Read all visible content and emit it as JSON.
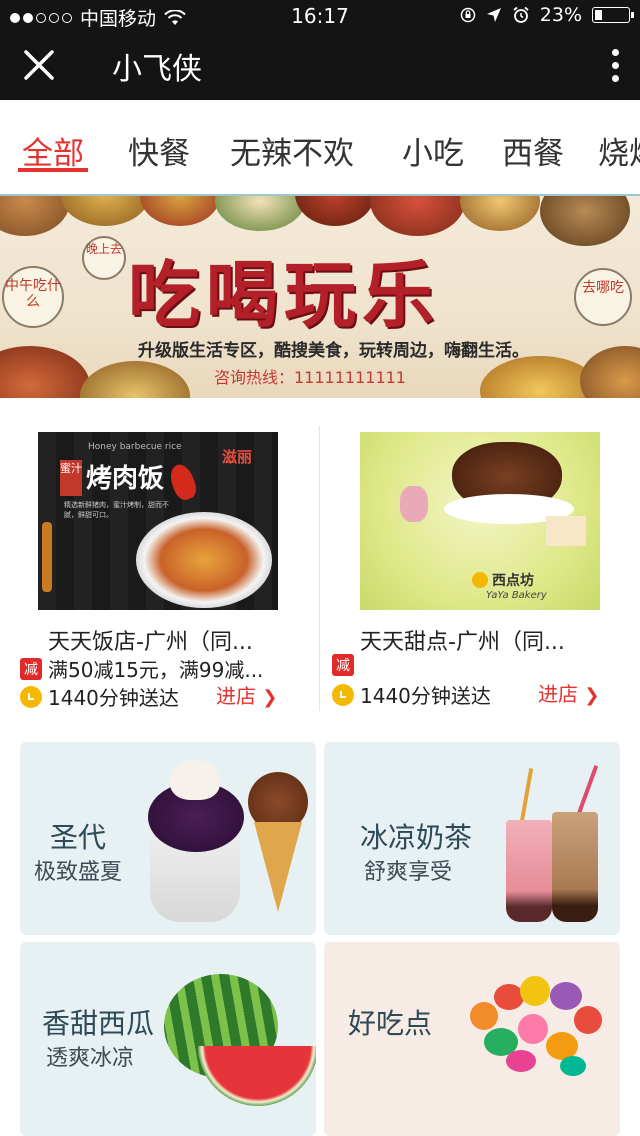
{
  "status_bar": {
    "carrier": "中国移动",
    "time": "16:17",
    "battery": "23%",
    "battery_level": 0.23
  },
  "nav": {
    "title": "小飞侠",
    "close_icon": "close-icon",
    "more_icon": "more-vertical-icon"
  },
  "tabs": [
    {
      "label": "全部",
      "active": true
    },
    {
      "label": "快餐"
    },
    {
      "label": "无辣不欢"
    },
    {
      "label": "小吃"
    },
    {
      "label": "西餐"
    },
    {
      "label": "烧烤"
    }
  ],
  "banner": {
    "headline": "吃喝玩乐",
    "subtitle": "升级版生活专区，酷搜美食，玩转周边，嗨翻生活。",
    "hotline": "咨询热线：11111111111",
    "bubble_left": "中午吃什么",
    "bubble_right": "去哪吃",
    "bubble_top": "晚上去"
  },
  "shops": [
    {
      "name": "天天饭店-广州（同...",
      "promo": "满50减15元，满99减...",
      "promo_badge": "减",
      "delivery": "1440分钟送达",
      "enter": "进店",
      "image_text": {
        "title": "烤肉饭",
        "brand": "滋丽",
        "tag": "蜜汁",
        "eng": "Honey barbecue rice",
        "desc": "精选新鲜猪肉，蜜汁烤制，甜而不腻，鲜甜可口。"
      }
    },
    {
      "name": "天天甜点-广州（同...",
      "promo": "",
      "promo_badge": "减",
      "delivery": "1440分钟送达",
      "enter": "进店",
      "image_text": {
        "brand": "西点坊",
        "eng": "YaYa Bakery"
      }
    }
  ],
  "tiles": [
    {
      "title": "圣代",
      "subtitle": "极致盛夏",
      "bg": "#e7f1f4"
    },
    {
      "title": "冰凉奶茶",
      "subtitle": "舒爽享受",
      "bg": "#e7f1f4"
    },
    {
      "title": "香甜西瓜",
      "subtitle": "透爽冰凉",
      "bg": "#e7f1f4"
    },
    {
      "title": "好吃点",
      "subtitle": "",
      "bg": "#f7ebe5"
    }
  ],
  "colors": {
    "accent": "#e5322e",
    "topbar": "#141414",
    "tile_blue": "#e7f1f4",
    "tile_pink": "#f7ebe5"
  }
}
